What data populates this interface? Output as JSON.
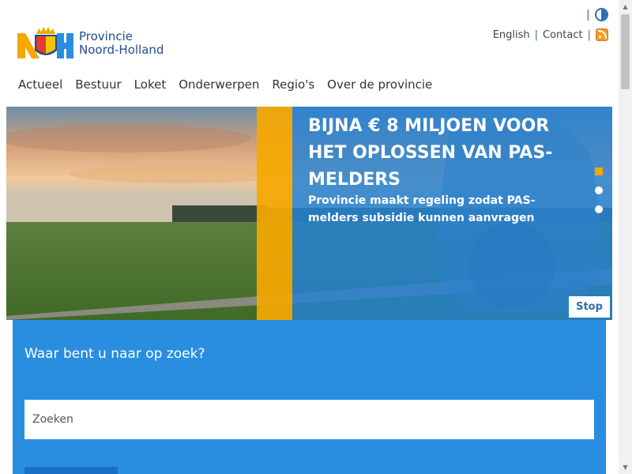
{
  "header": {
    "utility_links": [
      "English",
      "Contact"
    ],
    "logo_line1": "Provincie",
    "logo_line2": "Noord-Holland",
    "icons": {
      "contrast": "contrast-icon",
      "rss": "rss-icon"
    }
  },
  "nav": {
    "items": [
      "Actueel",
      "Bestuur",
      "Loket",
      "Onderwerpen",
      "Regio's",
      "Over de provincie"
    ]
  },
  "hero": {
    "title": "BIJNA € 8 MILJOEN VOOR HET OPLOSSEN VAN PAS-MELDERS",
    "subtitle": "Provincie maakt regeling zodat PAS-melders subsidie kunnen aanvragen",
    "stop_label": "Stop",
    "slide_count": 3,
    "active_slide": 1
  },
  "search": {
    "heading": "Waar bent u naar op zoek?",
    "placeholder": "Zoeken"
  },
  "colors": {
    "brand_blue": "#1f4d8c",
    "accent_blue": "#2a8ee0",
    "accent_yellow": "#f5a800"
  }
}
